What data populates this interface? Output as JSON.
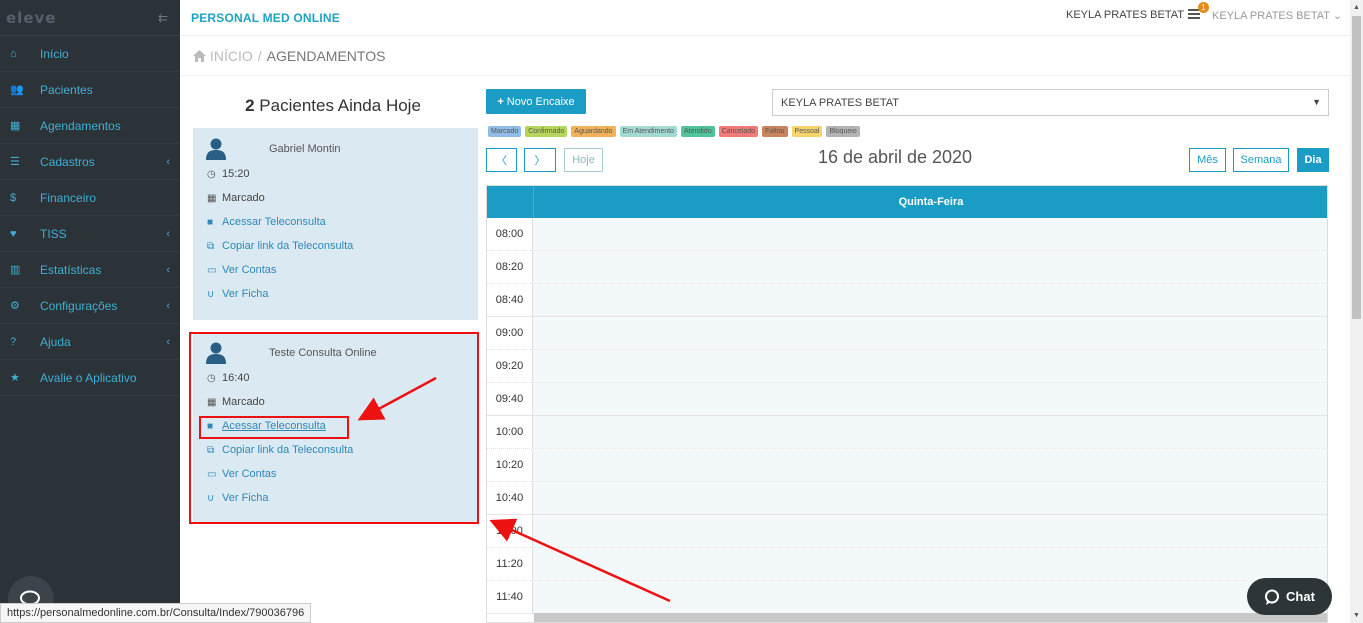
{
  "sidebar": {
    "logo": "eleve",
    "items": [
      {
        "label": "Início",
        "icon": "home-icon",
        "caret": false
      },
      {
        "label": "Pacientes",
        "icon": "users-icon",
        "caret": false
      },
      {
        "label": "Agendamentos",
        "icon": "calendar-icon",
        "caret": false
      },
      {
        "label": "Cadastros",
        "icon": "list-icon",
        "caret": true
      },
      {
        "label": "Financeiro",
        "icon": "dollar-icon",
        "caret": false
      },
      {
        "label": "TISS",
        "icon": "heartbeat-icon",
        "caret": true
      },
      {
        "label": "Estatísticas",
        "icon": "bar-chart-icon",
        "caret": true
      },
      {
        "label": "Configurações",
        "icon": "gear-icon",
        "caret": true
      },
      {
        "label": "Ajuda",
        "icon": "question-icon",
        "caret": true
      },
      {
        "label": "Avalie o Aplicativo",
        "icon": "star-icon",
        "caret": false
      }
    ]
  },
  "topbar": {
    "brand": "PERSONAL MED ONLINE",
    "user_name": "KEYLA PRATES BETAT",
    "notification_count": "1",
    "user_dropdown": "KEYLA PRATES BETAT"
  },
  "breadcrumb": {
    "home": "INÍCIO",
    "separator": "/",
    "current": "AGENDAMENTOS"
  },
  "patients": {
    "count": "2",
    "title_rest": "Pacientes Ainda Hoje",
    "cards": [
      {
        "name": "Gabriel Montin",
        "time": "15:20",
        "status": "Marcado",
        "teleconsulta": "Acessar Teleconsulta",
        "copy_link": "Copiar link da Teleconsulta",
        "contas": "Ver Contas",
        "ficha": "Ver Ficha"
      },
      {
        "name": "Teste Consulta Online",
        "time": "16:40",
        "status": "Marcado",
        "teleconsulta": "Acessar Teleconsulta",
        "copy_link": "Copiar link da Teleconsulta",
        "contas": "Ver Contas",
        "ficha": "Ver Ficha"
      }
    ]
  },
  "calendar": {
    "new_button": "Novo Encaixe",
    "professional_select": "KEYLA PRATES BETAT",
    "legend": [
      {
        "label": "Marcado",
        "color": "#8fbde6"
      },
      {
        "label": "Confirmado",
        "color": "#b5d65b"
      },
      {
        "label": "Aguardando",
        "color": "#f2b25c"
      },
      {
        "label": "Em Atendimento",
        "color": "#a3d9d1"
      },
      {
        "label": "Atendido",
        "color": "#4fc59b"
      },
      {
        "label": "Cancelado",
        "color": "#f17a7a"
      },
      {
        "label": "Faltou",
        "color": "#c8855f"
      },
      {
        "label": "Pessoal",
        "color": "#f6d36b"
      },
      {
        "label": "Bloqueio",
        "color": "#b3b3b3"
      }
    ],
    "today_button": "Hoje",
    "date_title": "16 de abril de 2020",
    "view_month": "Mês",
    "view_week": "Semana",
    "view_day": "Dia",
    "day_header": "Quinta-Feira",
    "times": [
      "08:00",
      "08:20",
      "08:40",
      "09:00",
      "09:20",
      "09:40",
      "10:00",
      "10:20",
      "10:40",
      "11:00",
      "11:20",
      "11:40"
    ],
    "accent_color": "#1a9cc4"
  },
  "statusbar": {
    "url": "https://personalmedonline.com.br/Consulta/Index/790036796"
  },
  "chat": {
    "label": "Chat"
  }
}
